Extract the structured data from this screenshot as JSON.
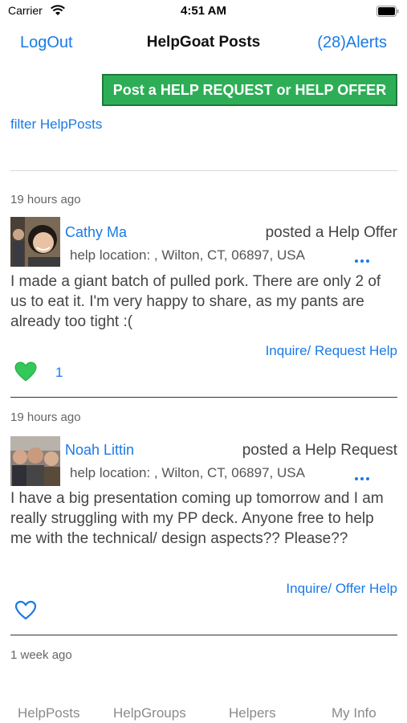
{
  "status_bar": {
    "carrier": "Carrier",
    "time": "4:51 AM",
    "icons": [
      "wifi-icon",
      "battery-icon"
    ]
  },
  "nav": {
    "left_button": "LogOut",
    "title": "HelpGoat Posts",
    "right_button": "(28)Alerts"
  },
  "cta": {
    "label": "Post a HELP REQUEST or HELP OFFER",
    "color": "#2dae56"
  },
  "filter": {
    "label": "filter HelpPosts"
  },
  "posts": [
    {
      "time": "19 hours ago",
      "name": "Cathy Ma",
      "type": "posted a Help Offer",
      "location": "help location: , Wilton, CT, 06897, USA",
      "body": "I made a giant batch of pulled pork. There are only 2 of us to eat it. I'm very happy to share, as my pants are already too tight :(",
      "action": "Inquire/ Request Help",
      "liked": true,
      "likes": "1"
    },
    {
      "time": "19 hours ago",
      "name": "Noah Littin",
      "type": "posted a Help Request",
      "location": "help location: , Wilton, CT, 06897, USA",
      "body": "I have a big presentation coming up tomorrow and I am really struggling with my PP deck. Anyone free to help me with the technical/ design aspects?? Please??",
      "action": "Inquire/ Offer Help",
      "liked": false,
      "likes": ""
    },
    {
      "time": "1 week ago"
    }
  ],
  "tabs": [
    "HelpPosts",
    "HelpGroups",
    "Helpers",
    "My Info"
  ],
  "colors": {
    "link": "#1a7ae6",
    "heart_filled": "#34c759"
  }
}
